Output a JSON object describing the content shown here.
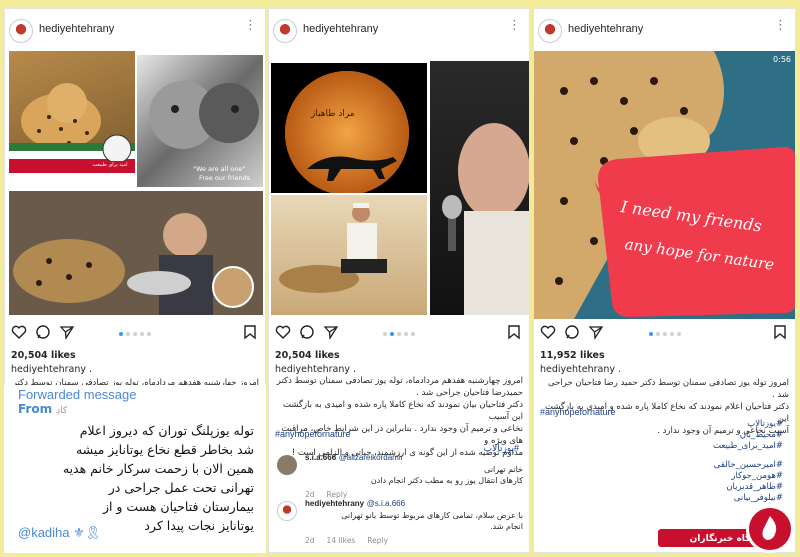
{
  "post1": {
    "username": "hediyehtehrany",
    "likes": "20,504 likes",
    "author": "hediyehtehrany .",
    "caption": "امروز چهارشنبه هفدهم مردادماه، توله یوز تصادفی سمنان توسط دکتر\nحمیدرضا فتاحیان جراحی شد .",
    "image_texts": {
      "sticker": "امید برای طبیعت",
      "we_are": "\"We are all one\"",
      "free": "Free our friends"
    },
    "forwarded": {
      "title": "Forwarded message",
      "from_label": "From",
      "from_name": "کادِ",
      "body": "توله یوزپلنگ توران که دیروز اعلام\nشد بخاطر قطع نخاع یوتانایز میشه\nهمین الان با زحمت سرکار خانم هدیه\nتهرانی تحت عمل جراحی در\nبیمارستان فتاحیان هست و از\nیوتانایز نجات پیدا کرد",
      "signature": "@kadiha ⚜🎗"
    }
  },
  "post2": {
    "username": "hediyehtehrany",
    "likes": "20,504 likes",
    "author": "hediyehtehrany .",
    "caption": "امروز چهارشنبه هفدهم مردادماه، توله یوز تصادفی سمنان توسط دکتر\nحمیدرضا فتاحیان جراحی شد .\nدکتر فتاحیان بیان نمودند که نخاع کاملا پاره شده و امیدی به بازگشت این آسیب\nنخاعی و ترمیم آن وجود ندارد . بنابراین در این شرایط خاص، مراقبت های ویژه و\nمداوم توصیه شده از این گونه ی ارزشمند، حیاتی و الزامی است !",
    "hashtag_en": "#anyhopefornature",
    "hashtag_fa": "#یوزتالاپ",
    "moon_text": "مراد طاهباز",
    "comments": [
      {
        "user": "s.i.a.666",
        "mention": "@alizareikordamir",
        "text": "خانم تهرانی\nکارهای انتقال یوز رو به مطب دکتر انجام دادن",
        "time": "2d",
        "action": "Reply"
      },
      {
        "user": "hediyehtehrany",
        "mention": "@s.i.a.666",
        "text": "با عرض سلام، تمامی کارهای مربوط توسط بانو تهرانی\nانجام شد.",
        "time": "2d",
        "likes": "14 likes",
        "action": "Reply"
      }
    ]
  },
  "post3": {
    "username": "hediyehtehrany",
    "likes": "11,952 likes",
    "author": "hediyehtehrany .",
    "caption": "امروز توله یوز تصادفی سمنان توسط دکتر حمید رضا فتاحیان جراحی شد .\nدکتر فتاحیان اعلام نمودند که نخاع کاملا پاره شده و امیدی به بازگشت این\nآسیب نخاعی و ترمیم آن وجود ندارد .",
    "video_time": "0:56",
    "sign_line1": "I need my friends",
    "sign_line2": "any hope for nature",
    "hashtag_en": "#anyhopefornature",
    "hashtags_fa": [
      "#یوزتالاپ",
      "#محیط_بان",
      "#امید_برای_طبیعت",
      "",
      "#امیرحسین_خالقی",
      "#هومن_جوکار",
      "#طاهر_قدیریان",
      "#نیلوفر_بیانی"
    ],
    "watermark": "باشگاه خبرنگاران"
  },
  "colors": {
    "bg": "#f2eb9a",
    "link": "#1a3f82",
    "telegram": "#4a88d0",
    "brand_red": "#c8102e",
    "dot_active": "#3897f0"
  }
}
